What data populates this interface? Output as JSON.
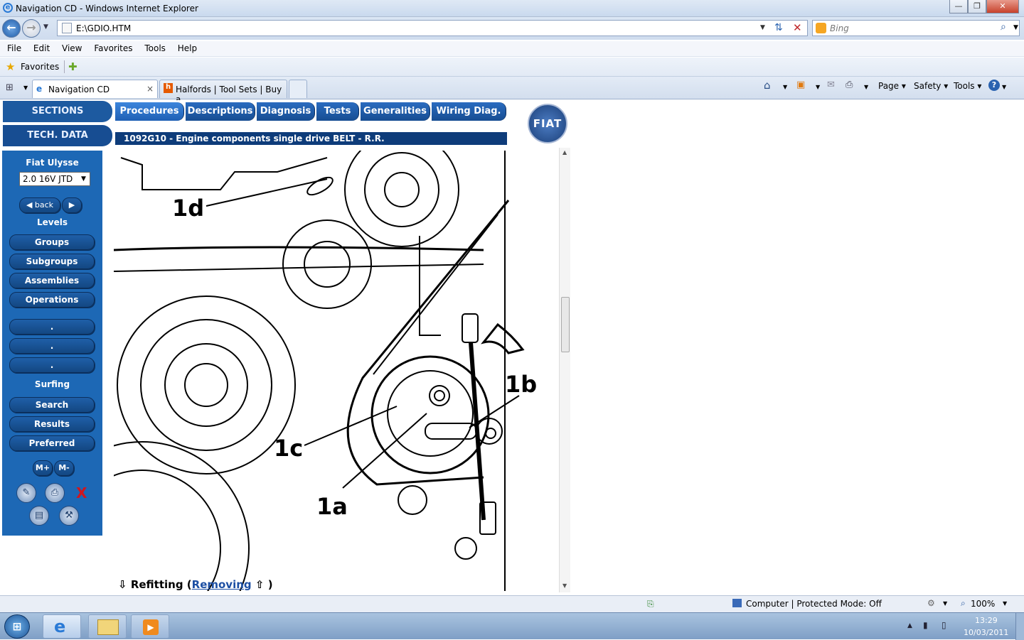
{
  "window": {
    "title": "Navigation CD - Windows Internet Explorer"
  },
  "address": {
    "url": "E:\\GDIO.HTM",
    "search_placeholder": "Bing"
  },
  "menu": [
    "File",
    "Edit",
    "View",
    "Favorites",
    "Tools",
    "Help"
  ],
  "favorites": {
    "label": "Favorites"
  },
  "tabs": [
    {
      "label": "Navigation CD"
    },
    {
      "label": "Halfords | Tool Sets | Buy a..."
    }
  ],
  "commands": {
    "page": "Page",
    "safety": "Safety",
    "tools": "Tools"
  },
  "app": {
    "sections": "SECTIONS",
    "tech_data": "TECH. DATA",
    "top_tabs": [
      "Procedures",
      "Descriptions",
      "Diagnosis",
      "Tests",
      "Generalities",
      "Wiring Diag."
    ],
    "doc_title": "1092G10 - Engine components single drive BELT - R.R.",
    "logo": "FIAT",
    "model_name": "Fiat Ulysse",
    "model_variant": "2.0 16V JTD",
    "back_label": "back",
    "levels_label": "Levels",
    "level_buttons": [
      "Groups",
      "Subgroups",
      "Assemblies",
      "Operations"
    ],
    "blank_buttons": [
      ".",
      ".",
      "."
    ],
    "surfing_label": "Surfing",
    "surf_buttons": [
      "Search",
      "Results",
      "Preferred"
    ],
    "mplus": "M+",
    "mminus": "M-",
    "drawing_callouts": [
      "1d",
      "1b",
      "1c",
      "1a"
    ],
    "refit_label": "Refitting (",
    "removing_link": "Removing",
    "refit_close": ")"
  },
  "status": {
    "zone": "Computer | Protected Mode: Off",
    "zoom": "100%"
  },
  "clock": {
    "time": "13:29",
    "date": "10/03/2011"
  },
  "colors": {
    "accent": "#1d68b5",
    "dark_blue": "#0e3c7a"
  }
}
